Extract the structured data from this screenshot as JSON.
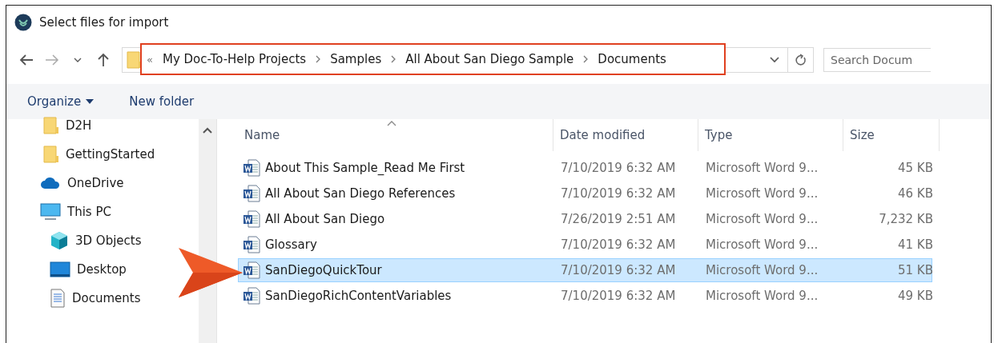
{
  "window": {
    "title": "Select files for import"
  },
  "address_bar": {
    "overflow": "«",
    "crumbs": [
      "My Doc-To-Help Projects",
      "Samples",
      "All About San Diego Sample",
      "Documents"
    ],
    "search_placeholder": "Search Docum"
  },
  "toolbar": {
    "organize": "Organize",
    "new_folder": "New folder"
  },
  "sidebar": {
    "items": [
      {
        "children": [
          {
            "kind": "folder",
            "label": "D2H"
          },
          {
            "kind": "folder",
            "label": "GettingStarted"
          }
        ]
      },
      {
        "kind": "cloud",
        "label": "OneDrive"
      },
      {
        "kind": "pc",
        "label": "This PC",
        "children": [
          {
            "kind": "cube",
            "label": "3D Objects"
          },
          {
            "kind": "desktop",
            "label": "Desktop"
          },
          {
            "kind": "document",
            "label": "Documents"
          }
        ]
      }
    ]
  },
  "table": {
    "columns": [
      "Name",
      "Date modified",
      "Type",
      "Size"
    ],
    "rows": [
      {
        "name": "About This Sample_Read Me First",
        "date": "7/10/2019 6:32 AM",
        "type": "Microsoft Word 9...",
        "size": "45 KB",
        "selected": false
      },
      {
        "name": "All About San Diego References",
        "date": "7/10/2019 6:32 AM",
        "type": "Microsoft Word 9...",
        "size": "46 KB",
        "selected": false
      },
      {
        "name": "All About San Diego",
        "date": "7/26/2019 2:51 AM",
        "type": "Microsoft Word 9...",
        "size": "7,232 KB",
        "selected": false
      },
      {
        "name": "Glossary",
        "date": "7/10/2019 6:32 AM",
        "type": "Microsoft Word 9...",
        "size": "41 KB",
        "selected": false
      },
      {
        "name": "SanDiegoQuickTour",
        "date": "7/10/2019 6:32 AM",
        "type": "Microsoft Word 9...",
        "size": "51 KB",
        "selected": true
      },
      {
        "name": "SanDiegoRichContentVariables",
        "date": "7/10/2019 6:32 AM",
        "type": "Microsoft Word 9...",
        "size": "49 KB",
        "selected": false
      }
    ]
  }
}
